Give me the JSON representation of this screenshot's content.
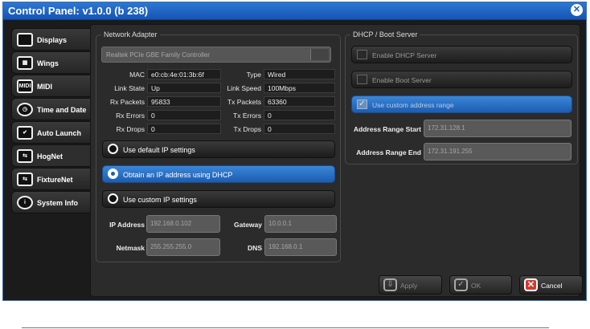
{
  "window": {
    "title": "Control Panel: v1.0.0 (b 238)",
    "close_glyph": "✕"
  },
  "tabs": [
    {
      "label": "Displays",
      "icon": "monitor-icon",
      "glyph": ""
    },
    {
      "label": "Wings",
      "icon": "wing-icon",
      "glyph": "▦"
    },
    {
      "label": "MIDI",
      "icon": "midi-icon",
      "glyph": "MIDI"
    },
    {
      "label": "Time and Date",
      "icon": "clock-icon",
      "glyph": "◷"
    },
    {
      "label": "Auto Launch",
      "icon": "auto-launch-icon",
      "glyph": "✔"
    },
    {
      "label": "HogNet",
      "icon": "network-icon",
      "glyph": "⇆"
    },
    {
      "label": "FixtureNet",
      "icon": "fixture-network-icon",
      "glyph": "⇆"
    },
    {
      "label": "System Info",
      "icon": "info-icon",
      "glyph": "i"
    }
  ],
  "adapter": {
    "title": "Network Adapter",
    "selected": "Realtek PCIe GBE Family Controller",
    "fields": {
      "mac_label": "MAC",
      "mac": "e0:cb:4e:01:3b:6f",
      "type_label": "Type",
      "type": "Wired",
      "link_state_label": "Link State",
      "link_state": "Up",
      "link_speed_label": "Link Speed",
      "link_speed": "100Mbps",
      "rx_packets_label": "Rx Packets",
      "rx_packets": "95833",
      "tx_packets_label": "Tx Packets",
      "tx_packets": "63360",
      "rx_errors_label": "Rx Errors",
      "rx_errors": "0",
      "tx_errors_label": "Tx Errors",
      "tx_errors": "0",
      "rx_drops_label": "Rx Drops",
      "rx_drops": "0",
      "tx_drops_label": "Tx Drops",
      "tx_drops": "0"
    }
  },
  "ip_mode": {
    "options": [
      {
        "label": "Use default IP settings",
        "selected": false
      },
      {
        "label": "Obtain an IP address using DHCP",
        "selected": true
      },
      {
        "label": "Use custom IP settings",
        "selected": false
      }
    ]
  },
  "ip": {
    "address_label": "IP Address",
    "address": "192.168.0.102",
    "gateway_label": "Gateway",
    "gateway": "10.0.0.1",
    "netmask_label": "Netmask",
    "netmask": "255.255.255.0",
    "dns_label": "DNS",
    "dns": "192.168.0.1"
  },
  "dhcp": {
    "title": "DHCP / Boot Server",
    "enable_dhcp": "Enable DHCP Server",
    "enable_boot": "Enable Boot Server",
    "custom_range": "Use custom address range",
    "check_glyph": "✓",
    "range_start_label": "Address Range Start",
    "range_start": "172.31.128.1",
    "range_end_label": "Address Range End",
    "range_end": "172.31.191.255"
  },
  "buttons": {
    "apply": "Apply",
    "ok": "OK",
    "cancel": "Cancel",
    "cancel_glyph": "✕",
    "ok_glyph": "✓",
    "apply_glyph": "⇩"
  },
  "colors": {
    "title_bar": "#1f66c6",
    "selected": "#2a73c9",
    "cancel_icon": "#d23a30"
  }
}
